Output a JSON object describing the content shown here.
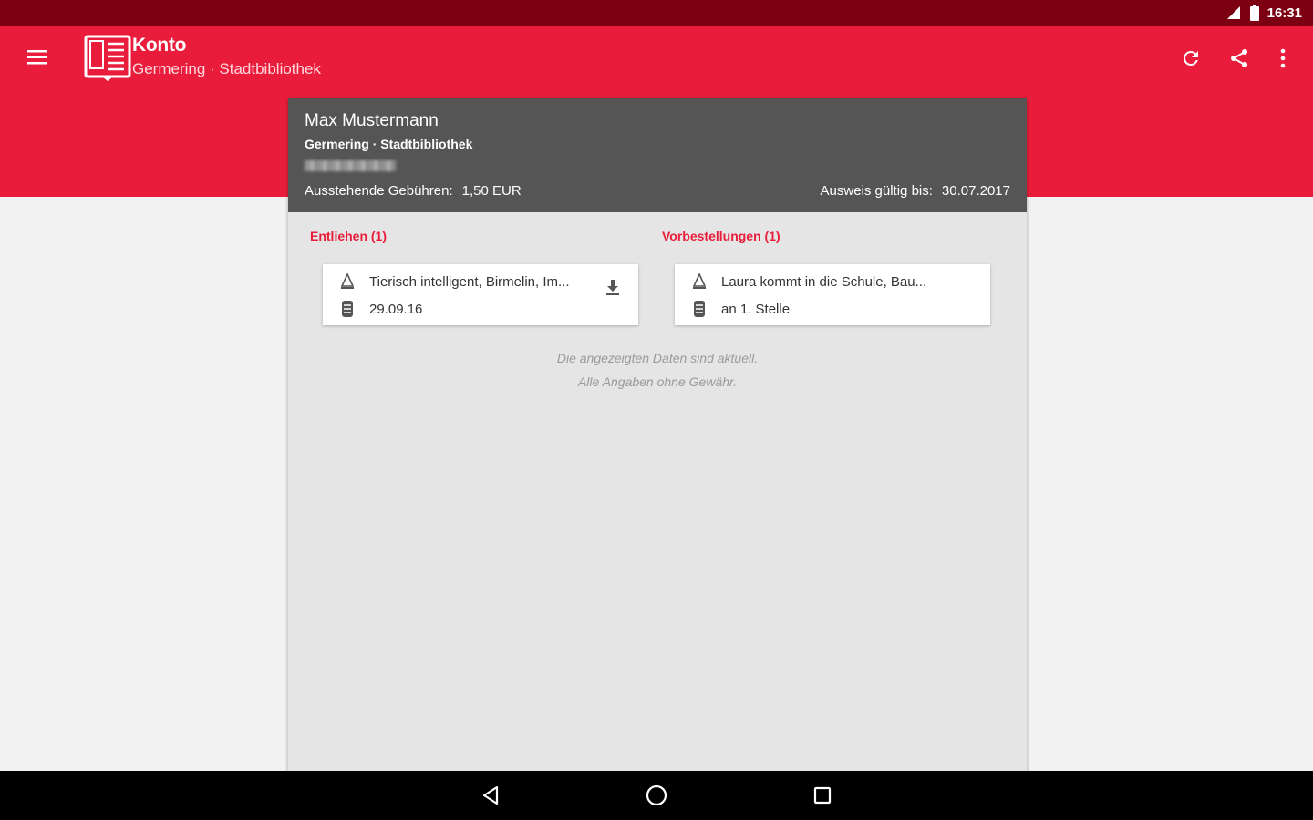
{
  "status_bar": {
    "time": "16:31",
    "icons": [
      "signal-icon",
      "battery-icon"
    ]
  },
  "app_bar": {
    "title": "Konto",
    "subtitle": "Germering · Stadtbibliothek",
    "actions": [
      "refresh-icon",
      "share-icon",
      "more-vert-icon"
    ]
  },
  "account": {
    "name": "Max Mustermann",
    "library": "Germering · Stadtbibliothek",
    "fees_label": "Ausstehende Gebühren:",
    "fees_value": "1,50 EUR",
    "valid_label": "Ausweis gültig bis:",
    "valid_value": "30.07.2017"
  },
  "lent": {
    "title": "Entliehen (1)",
    "items": [
      {
        "title": "Tierisch intelligent, Birmelin, Im...",
        "date": "29.09.16"
      }
    ]
  },
  "reservations": {
    "title": "Vorbestellungen (1)",
    "items": [
      {
        "title": "Laura kommt in die Schule, Bau...",
        "position": "an 1. Stelle"
      }
    ]
  },
  "footnote": {
    "line1": "Die angezeigten Daten sind aktuell.",
    "line2": "Alle Angaben ohne Gewähr."
  },
  "colors": {
    "primary": "#e91d3b",
    "primary_dark": "#7d0012",
    "header": "#555555"
  }
}
